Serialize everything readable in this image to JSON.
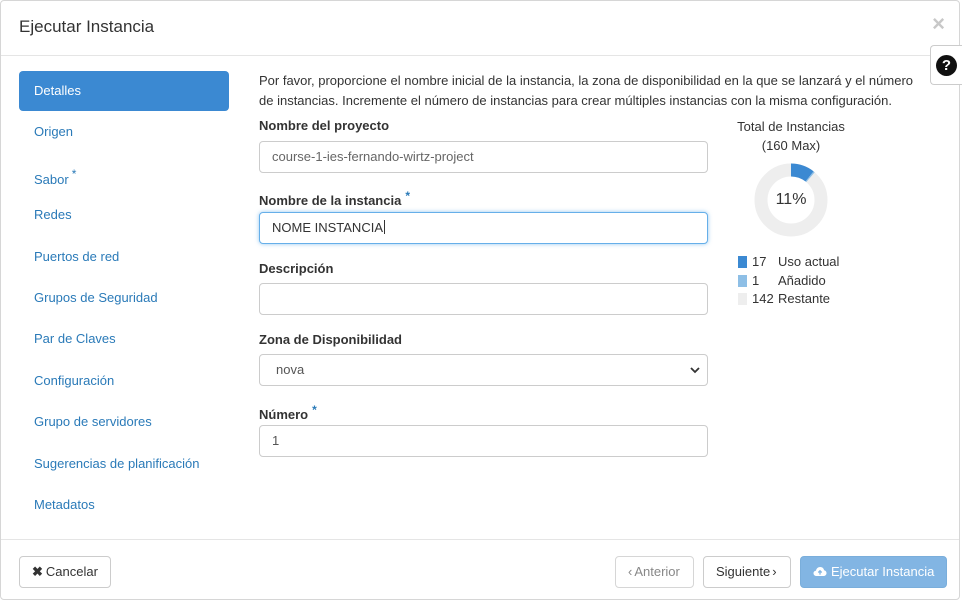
{
  "header": {
    "title": "Ejecutar Instancia",
    "close_glyph": "×",
    "help_glyph": "?"
  },
  "nav": {
    "items": [
      {
        "label": "Detalles"
      },
      {
        "label": "Origen"
      },
      {
        "label": "Sabor",
        "required_mark": "*"
      },
      {
        "label": "Redes"
      },
      {
        "label": "Puertos de red"
      },
      {
        "label": "Grupos de Seguridad"
      },
      {
        "label": "Par de Claves"
      },
      {
        "label": "Configuración"
      },
      {
        "label": "Grupo de servidores"
      },
      {
        "label": "Sugerencias de planificación"
      },
      {
        "label": "Metadatos"
      }
    ]
  },
  "form": {
    "intro": "Por favor, proporcione el nombre inicial de la instancia, la zona de disponibilidad en la que se lanzará y el número de instancias. Incremente el número de instancias para crear múltiples instancias con la misma configuración.",
    "project_label": "Nombre del proyecto",
    "project_value": "course-1-ies-fernando-wirtz-project",
    "instance_name_label": "Nombre de la instancia",
    "instance_name_required": "*",
    "instance_name_value": "NOME INSTANCIA",
    "description_label": "Descripción",
    "description_value": "",
    "zone_label": "Zona de Disponibilidad",
    "zone_selected": "nova",
    "number_label": "Número",
    "number_required": "*",
    "number_value": "1"
  },
  "quota": {
    "title": "Total de Instancias",
    "max": "(160 Max)",
    "percent_label": "11%",
    "used": 17,
    "added": 1,
    "remaining": 142,
    "total": 160,
    "legend": [
      {
        "count": "17",
        "label": "Uso actual",
        "color": "#3b89d2"
      },
      {
        "count": "1",
        "label": "Añadido",
        "color": "#8ebfe6"
      },
      {
        "count": "142",
        "label": "Restante",
        "color": "#eeeeee"
      }
    ]
  },
  "footer": {
    "cancel_label": "Cancelar",
    "back_label": "Anterior",
    "next_label": "Siguiente",
    "launch_label": "Ejecutar Instancia"
  },
  "colors": {
    "accent": "#3b89d2",
    "link": "#2a7ab8",
    "primary_disabled": "#82b5e3"
  }
}
